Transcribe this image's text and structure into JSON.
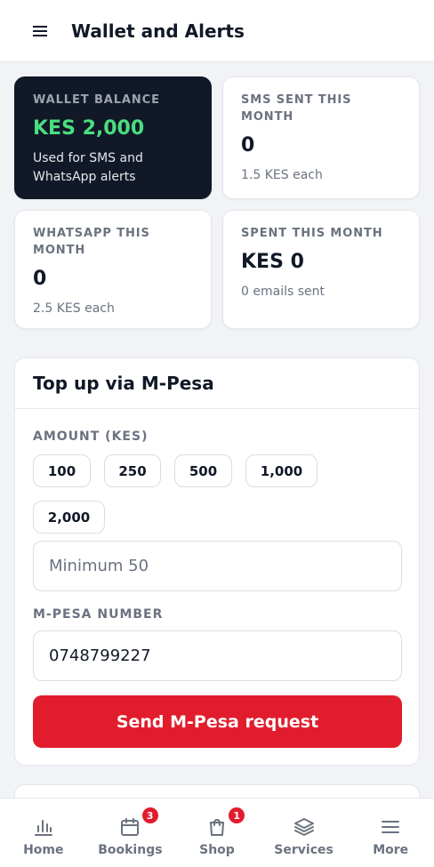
{
  "header": {
    "title": "Wallet and Alerts"
  },
  "stats": [
    {
      "label": "WALLET BALANCE",
      "value": "KES 2,000",
      "sub": "Used for SMS and WhatsApp alerts"
    },
    {
      "label": "SMS SENT THIS MONTH",
      "value": "0",
      "sub": "1.5 KES each"
    },
    {
      "label": "WHATSAPP THIS MONTH",
      "value": "0",
      "sub": "2.5 KES each"
    },
    {
      "label": "SPENT THIS MONTH",
      "value": "KES 0",
      "sub": "0 emails sent"
    }
  ],
  "topup": {
    "title": "Top up via M-Pesa",
    "amount_label": "AMOUNT (KES)",
    "amounts": [
      "100",
      "250",
      "500",
      "1,000",
      "2,000"
    ],
    "amount_placeholder": "Minimum 50",
    "number_label": "M-PESA NUMBER",
    "number_value": "0748799227",
    "send_label": "Send M-Pesa request"
  },
  "nav": {
    "items": [
      {
        "label": "Home",
        "icon": "bar-chart-icon",
        "badge": null
      },
      {
        "label": "Bookings",
        "icon": "calendar-icon",
        "badge": "3"
      },
      {
        "label": "Shop",
        "icon": "shopping-bag-icon",
        "badge": "1"
      },
      {
        "label": "Services",
        "icon": "layers-icon",
        "badge": null
      },
      {
        "label": "More",
        "icon": "menu-icon",
        "badge": null
      }
    ]
  },
  "colors": {
    "accent_red": "#e11d2d",
    "balance_green": "#4ade80",
    "dark_card": "#111827"
  }
}
